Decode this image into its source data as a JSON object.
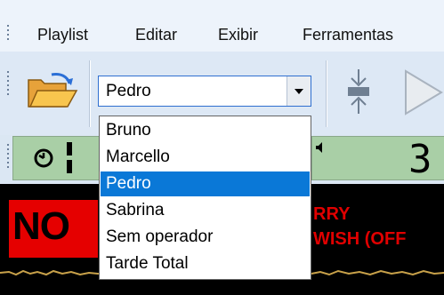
{
  "menu": {
    "items": [
      "Playlist",
      "Editar",
      "Exibir",
      "Ferramentas"
    ]
  },
  "toolbar": {
    "operator_combo": {
      "value": "Pedro",
      "options": [
        "Bruno",
        "Marcello",
        "Pedro",
        "Sabrina",
        "Sem operador",
        "Tarde Total"
      ],
      "selected_index": 2
    }
  },
  "status": {
    "right_digit": "3"
  },
  "on_air": {
    "label": "NO",
    "line1": "RRY",
    "line2": "WISH (OFF"
  },
  "colors": {
    "selection": "#0a78d7",
    "display_green": "#a9cfa6",
    "alert_red": "#e50000"
  }
}
